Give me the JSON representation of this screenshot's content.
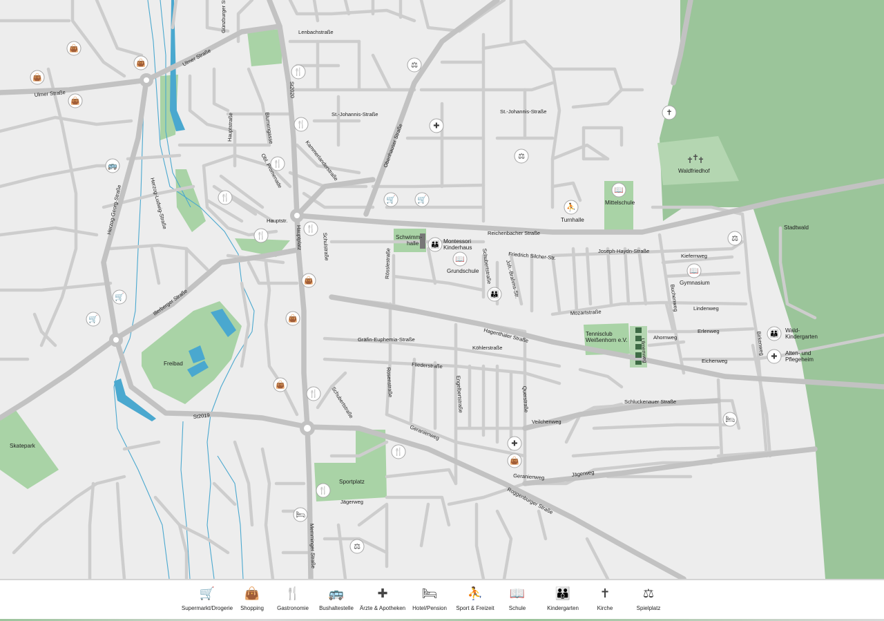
{
  "map": {
    "streets": [
      "Lenbachstraße",
      "Günzburger Straße",
      "Ulmer Straße",
      "Ulmer Straße",
      "St2020",
      "St.-Johannis-Straße",
      "St.-Johannis-Straße",
      "Hauptstraße",
      "Blumengasse",
      "Kammerlanderstraße",
      "Obenhauser Straße",
      "Obl. Promenade",
      "Herzog-Georg-Straße",
      "Herzog-Ludwig-Straße",
      "Hauptstr.",
      "Hauptplatz",
      "Schulstraße",
      "Reichenbacher Straße",
      "Joseph-Haydn-Straße",
      "Friedrich Silcher-Str.",
      "Joh.-Brahms-Str.",
      "Schubertstraße",
      "Rösslestraße",
      "Kiefernweg",
      "Buchenweg",
      "Lindenweg",
      "Mozartstraße",
      "Illerberger Straße",
      "Hagenthaler Straße",
      "Gräfin-Euphemia-Straße",
      "Köhlerstraße",
      "Erlenweg",
      "Ahornweg",
      "Birkenweg",
      "Ulmenweg",
      "Eichenweg",
      "Fliederstraße",
      "Rosenstraße",
      "Engelbertstraße",
      "Querstraße",
      "Schluckenauer Straße",
      "Veilchenweg",
      "Schubertstraße",
      "St2019",
      "Geranienweg",
      "Geranienweg",
      "Jägerweg",
      "Jägerweg",
      "Roggenburger Straße",
      "Memminger Straße"
    ],
    "areas": [
      "Waldfriedhof",
      "Stadtwald",
      "Mittelschule",
      "Turnhalle",
      "Schwimm-",
      "halle",
      "Montessori",
      "Kinderhaus",
      "Grundschule",
      "Gymnasium",
      "Tennisclub",
      "Weißenhorn e.V.",
      "Wald-",
      "Kindergarten",
      "Alten- und",
      "Pflegeheim",
      "Freibad",
      "Skatepark",
      "Sportplatz"
    ]
  },
  "legend": [
    {
      "label": "Supermarkt/Drogerie",
      "icon": "supermarket-icon",
      "glyph": "🛒"
    },
    {
      "label": "Shopping",
      "icon": "shopping-bag-icon",
      "glyph": "👜"
    },
    {
      "label": "Gastronomie",
      "icon": "restaurant-icon",
      "glyph": "🍴"
    },
    {
      "label": "Bushaltestelle",
      "icon": "bus-icon",
      "glyph": "🚌"
    },
    {
      "label": "Ärzte & Apotheken",
      "icon": "medical-cross-icon",
      "glyph": "✚"
    },
    {
      "label": "Hotel/Pension",
      "icon": "bed-icon",
      "glyph": "🛏"
    },
    {
      "label": "Sport & Freizeit",
      "icon": "sport-icon",
      "glyph": "⛹"
    },
    {
      "label": "Schule",
      "icon": "school-icon",
      "glyph": "📖"
    },
    {
      "label": "Kindergarten",
      "icon": "kindergarten-icon",
      "glyph": "👪"
    },
    {
      "label": "Kirche",
      "icon": "church-cross-icon",
      "glyph": "✝"
    },
    {
      "label": "Spielplatz",
      "icon": "playground-icon",
      "glyph": "⚖"
    }
  ],
  "colors": {
    "background": "#ededed",
    "road": "#c9c9c9",
    "main_road": "#bdbdbd",
    "green_area": "#9ec79c",
    "park": "#a9d3a6",
    "water": "#4aa8cf",
    "building": "#3e6b45"
  }
}
